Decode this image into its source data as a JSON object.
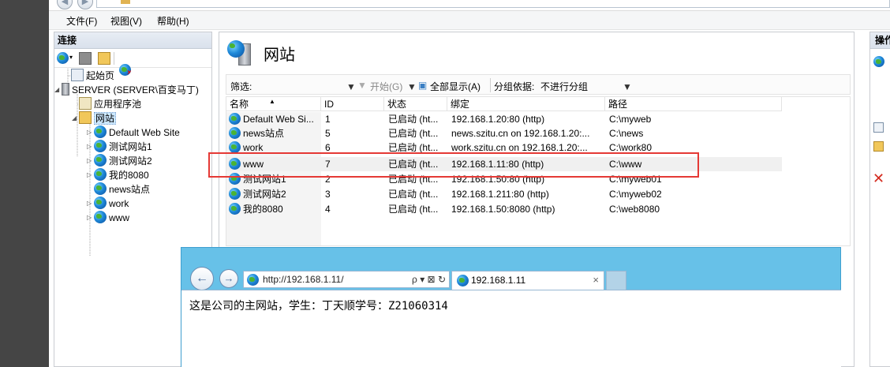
{
  "menu": {
    "file": "文件(F)",
    "view": "视图(V)",
    "help": "帮助(H)"
  },
  "connections": {
    "title": "连接",
    "tree": {
      "start_page": "起始页",
      "server": "SERVER (SERVER\\百变马丁)",
      "app_pools": "应用程序池",
      "sites": "网站",
      "site_items": [
        "Default Web Site",
        "测试网站1",
        "测试网站2",
        "我的8080",
        "news站点",
        "work",
        "www"
      ]
    }
  },
  "main": {
    "title": "网站",
    "filter_label": "筛选:",
    "go_label": "开始(G)",
    "show_all_label": "全部显示(A)",
    "group_by_label": "分组依据:",
    "group_by_value": "不进行分组",
    "columns": [
      "名称",
      "ID",
      "状态",
      "绑定",
      "路径"
    ],
    "rows": [
      {
        "name": "Default Web Si...",
        "id": "1",
        "status": "已启动 (ht...",
        "binding": "192.168.1.20:80 (http)",
        "path": "C:\\myweb"
      },
      {
        "name": "news站点",
        "id": "5",
        "status": "已启动 (ht...",
        "binding": "news.szitu.cn on 192.168.1.20:...",
        "path": "C:\\news"
      },
      {
        "name": "work",
        "id": "6",
        "status": "已启动 (ht...",
        "binding": "work.szitu.cn on 192.168.1.20:...",
        "path": "C:\\work80"
      },
      {
        "name": "www",
        "id": "7",
        "status": "已启动 (ht...",
        "binding": "192.168.1.11:80 (http)",
        "path": "C:\\www"
      },
      {
        "name": "测试网站1",
        "id": "2",
        "status": "已启动 (ht...",
        "binding": "192.168.1.50:80 (http)",
        "path": "C:\\myweb01"
      },
      {
        "name": "测试网站2",
        "id": "3",
        "status": "已启动 (ht...",
        "binding": "192.168.1.211:80 (http)",
        "path": "C:\\myweb02"
      },
      {
        "name": "我的8080",
        "id": "4",
        "status": "已启动 (ht...",
        "binding": "192.168.1.50:8080 (http)",
        "path": "C:\\web8080"
      }
    ]
  },
  "actions": {
    "title": "操作"
  },
  "browser": {
    "address": "http://192.168.1.11/",
    "address_controls": "ρ ▾ ⊠ ↻",
    "tab_title": "192.168.1.11",
    "tab_close": "×",
    "page_text": "这是公司的主网站，学生：丁天顺学号：Z21060314"
  },
  "colors": {
    "highlight_box": "#e53935",
    "browser_frame": "#67c1e8",
    "tree_selection": "#cce8ff"
  }
}
